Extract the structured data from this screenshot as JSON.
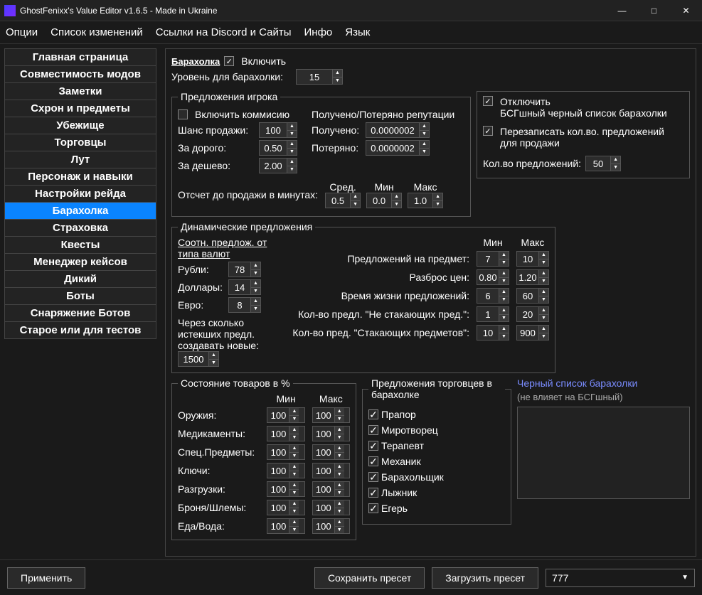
{
  "window": {
    "title": "GhostFenixx's Value Editor v1.6.5 - Made in Ukraine"
  },
  "menu": [
    "Опции",
    "Список изменений",
    "Ссылки на Discord и Сайты",
    "Инфо",
    "Язык"
  ],
  "nav": [
    "Главная страница",
    "Совместимость модов",
    "Заметки",
    "Схрон и предметы",
    "Убежище",
    "Торговцы",
    "Лут",
    "Персонаж и навыки",
    "Настройки рейда",
    "Барахолка",
    "Страховка",
    "Квесты",
    "Менеджер кейсов",
    "Дикий",
    "Боты",
    "Снаряжение Ботов",
    "Старое или для тестов"
  ],
  "nav_active": 9,
  "header": {
    "title": "Барахолка",
    "enable": "Включить"
  },
  "level": {
    "label": "Уровень для барахолки:",
    "value": "15"
  },
  "offers": {
    "legend": "Предложения игрока",
    "commission": "Включить коммисию",
    "rep_header": "Получено/Потеряно репутации",
    "chance": {
      "label": "Шанс продажи:",
      "value": "100"
    },
    "expensive": {
      "label": "За дорого:",
      "value": "0.50"
    },
    "cheap": {
      "label": "За дешево:",
      "value": "2.00"
    },
    "gained": {
      "label": "Получено:",
      "value": "0.0000002"
    },
    "lost": {
      "label": "Потеряно:",
      "value": "0.0000002"
    },
    "countdown_label": "Отсчет до продажи в минутах:",
    "avg_h": "Сред.",
    "min_h": "Мин",
    "max_h": "Макс",
    "avg": "0.5",
    "min": "0.0",
    "max": "1.0"
  },
  "right": {
    "disable_label": "Отключить",
    "bsg_label": "БСГшный черный список барахолки",
    "override_label": "Перезаписать кол.во. предложений для продажи",
    "num_label": "Кол.во предложений:",
    "num_value": "50"
  },
  "dyn": {
    "legend": "Динамические предложения",
    "ratio_label": "Соотн. предлож. от типа валют",
    "rub": {
      "label": "Рубли:",
      "value": "78"
    },
    "usd": {
      "label": "Доллары:",
      "value": "14"
    },
    "eur": {
      "label": "Евро:",
      "value": "8"
    },
    "expired_label1": "Через сколько",
    "expired_label2": "истекших предл.",
    "expired_label3": "создавать новые:",
    "expired_value": "1500",
    "min_h": "Мин",
    "max_h": "Макс",
    "per_item": {
      "label": "Предложений на предмет:",
      "min": "7",
      "max": "10"
    },
    "price": {
      "label": "Разброс цен:",
      "min": "0.80",
      "max": "1.20"
    },
    "life": {
      "label": "Время жизни предложений:",
      "min": "6",
      "max": "60"
    },
    "nonstack": {
      "label": "Кол-во предл. \"Не стакающих пред.\":",
      "min": "1",
      "max": "20"
    },
    "stack": {
      "label": "Кол-во пред. \"Стакающих предметов\":",
      "min": "10",
      "max": "900"
    }
  },
  "cond": {
    "legend": "Состояние товаров в %",
    "min_h": "Мин",
    "max_h": "Макс",
    "rows": [
      {
        "label": "Оружия:",
        "min": "100",
        "max": "100"
      },
      {
        "label": "Медикаменты:",
        "min": "100",
        "max": "100"
      },
      {
        "label": "Спец.Предметы:",
        "min": "100",
        "max": "100"
      },
      {
        "label": "Ключи:",
        "min": "100",
        "max": "100"
      },
      {
        "label": "Разгрузки:",
        "min": "100",
        "max": "100"
      },
      {
        "label": "Броня/Шлемы:",
        "min": "100",
        "max": "100"
      },
      {
        "label": "Еда/Вода:",
        "min": "100",
        "max": "100"
      }
    ]
  },
  "traders": {
    "legend": "Предложения торговцев в барахолке",
    "list": [
      "Прапор",
      "Миротворец",
      "Терапевт",
      "Механик",
      "Барахольщик",
      "Лыжник",
      "Егерь"
    ]
  },
  "blacklist": {
    "title": "Черный список барахолки",
    "sub": "(не влияет на БСГшный)"
  },
  "footer": {
    "apply": "Применить",
    "save": "Сохранить пресет",
    "load": "Загрузить пресет",
    "preset": "777"
  }
}
